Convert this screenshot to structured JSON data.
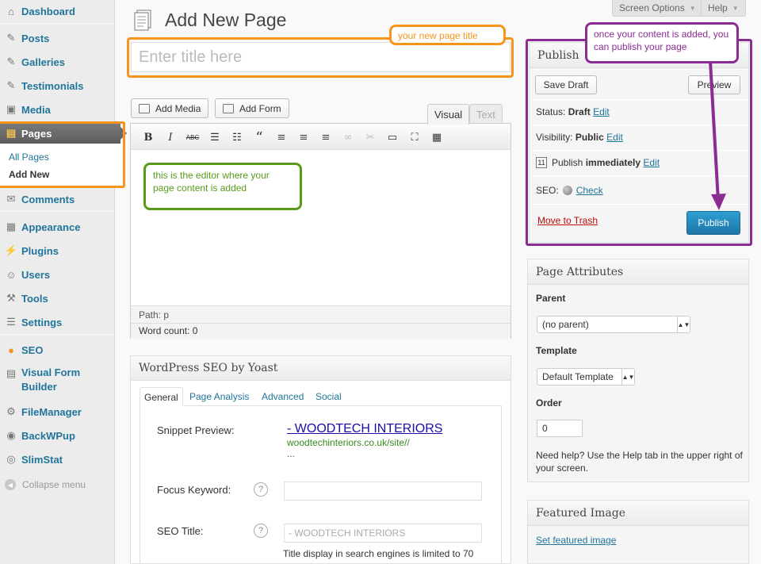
{
  "sidebar": {
    "items": [
      {
        "label": "Dashboard",
        "icon": "dashboard-icon"
      },
      {
        "label": "Posts",
        "icon": "pin-icon"
      },
      {
        "label": "Galleries",
        "icon": "pin-icon"
      },
      {
        "label": "Testimonials",
        "icon": "pin-icon"
      },
      {
        "label": "Media",
        "icon": "media-icon"
      },
      {
        "label": "Pages",
        "icon": "pages-icon"
      },
      {
        "label": "Comments",
        "icon": "comment-icon"
      },
      {
        "label": "Appearance",
        "icon": "appearance-icon"
      },
      {
        "label": "Plugins",
        "icon": "plugin-icon"
      },
      {
        "label": "Users",
        "icon": "users-icon"
      },
      {
        "label": "Tools",
        "icon": "tools-icon"
      },
      {
        "label": "Settings",
        "icon": "settings-icon"
      },
      {
        "label": "SEO",
        "icon": "seo-icon"
      },
      {
        "label": "Visual Form Builder",
        "icon": "form-icon"
      },
      {
        "label": "FileManager",
        "icon": "gear-icon"
      },
      {
        "label": "BackWPup",
        "icon": "backup-icon"
      },
      {
        "label": "SlimStat",
        "icon": "stats-icon"
      }
    ],
    "pages_submenu": [
      "All Pages",
      "Add New"
    ],
    "collapse_label": "Collapse menu"
  },
  "top": {
    "screen_options": "Screen Options",
    "help": "Help"
  },
  "header": {
    "title": "Add New Page"
  },
  "title_field": {
    "placeholder": "Enter title here"
  },
  "callouts": {
    "title": "your new page title",
    "editor": "this is the editor where your page content is added",
    "publish": "once your content is added, you can publish your page"
  },
  "editor": {
    "add_media": "Add Media",
    "add_form": "Add Form",
    "tab_visual": "Visual",
    "tab_text": "Text",
    "toolbar": [
      "B",
      "I",
      "ABC",
      "bullets",
      "numbers",
      "“",
      "align-left",
      "align-center",
      "align-right",
      "link",
      "unlink",
      "more",
      "fullscreen",
      "kitchen-sink"
    ],
    "path": "Path: p",
    "word_count": "Word count: 0"
  },
  "yoast": {
    "title": "WordPress SEO by Yoast",
    "tabs": [
      "General",
      "Page Analysis",
      "Advanced",
      "Social"
    ],
    "snippet_label": "Snippet Preview:",
    "snippet_title": "- WOODTECH INTERIORS",
    "snippet_url": "woodtechinteriors.co.uk/site//",
    "snippet_desc": "...",
    "focus_label": "Focus Keyword:",
    "seo_title_label": "SEO Title:",
    "seo_title_placeholder": "- WOODTECH INTERIORS",
    "seo_title_note": "Title display in search engines is limited to 70"
  },
  "publish": {
    "title": "Publish",
    "save_draft": "Save Draft",
    "preview": "Preview",
    "status_label": "Status:",
    "status_value": "Draft",
    "visibility_label": "Visibility:",
    "visibility_value": "Public",
    "publish_label": "Publish",
    "publish_value": "immediately",
    "edit": "Edit",
    "seo_label": "SEO:",
    "seo_check": "Check",
    "trash": "Move to Trash",
    "publish_button": "Publish"
  },
  "attributes": {
    "title": "Page Attributes",
    "parent_label": "Parent",
    "parent_value": "(no parent)",
    "template_label": "Template",
    "template_value": "Default Template",
    "order_label": "Order",
    "order_value": "0",
    "help_text": "Need help? Use the Help tab in the upper right of your screen."
  },
  "featured": {
    "title": "Featured Image",
    "link": "Set featured image"
  },
  "colors": {
    "link": "#21759b",
    "title_callout": "#f7941d",
    "editor_callout": "#5a9a1a",
    "publish_callout": "#8b2c93",
    "publish_button": "#2385bd"
  }
}
